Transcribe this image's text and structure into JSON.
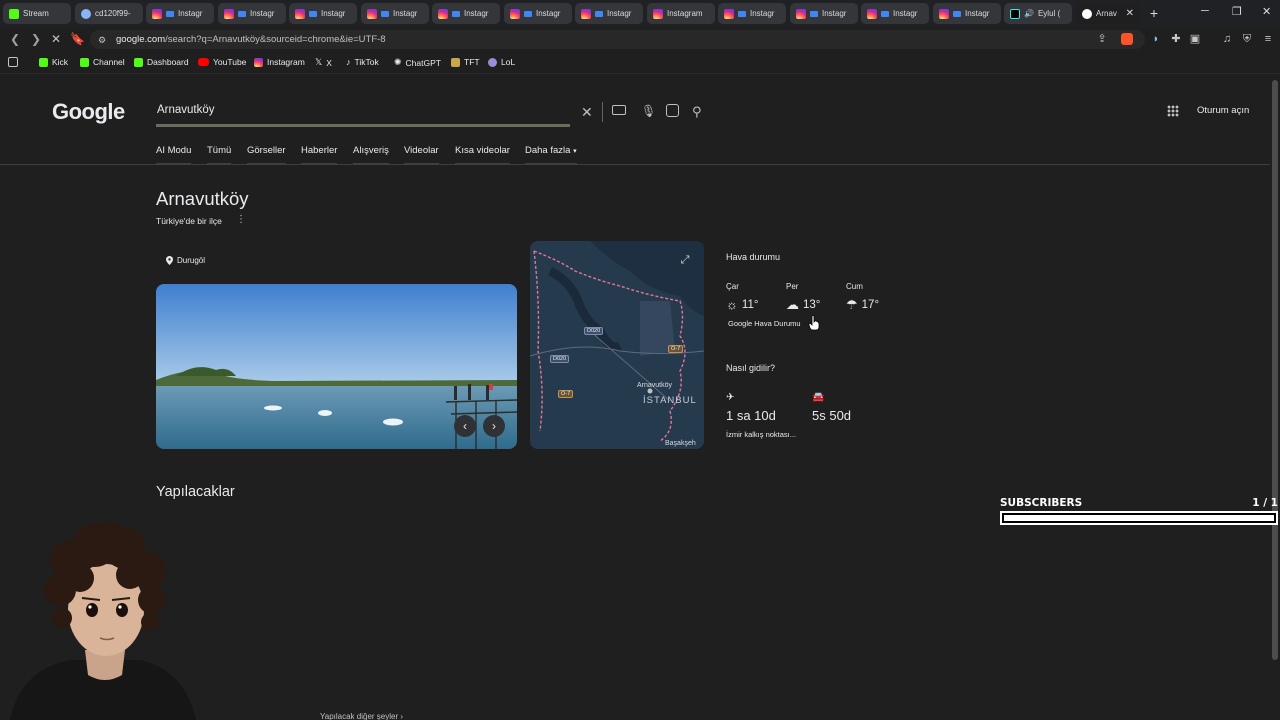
{
  "browser": {
    "tabs": [
      {
        "label": "Stream",
        "icon": "kick-icon"
      },
      {
        "label": "cd120f99-",
        "icon": "chrome-icon"
      },
      {
        "label": "Instagr",
        "icon": "instagram-icon"
      },
      {
        "label": "Instagr",
        "icon": "instagram-icon"
      },
      {
        "label": "Instagr",
        "icon": "instagram-icon"
      },
      {
        "label": "Instagr",
        "icon": "instagram-icon"
      },
      {
        "label": "Instagr",
        "icon": "instagram-icon"
      },
      {
        "label": "Instagr",
        "icon": "instagram-icon"
      },
      {
        "label": "Instagr",
        "icon": "instagram-icon"
      },
      {
        "label": "Instagram",
        "icon": "instagram-icon"
      },
      {
        "label": "Instagr",
        "icon": "instagram-icon"
      },
      {
        "label": "Instagr",
        "icon": "instagram-icon"
      },
      {
        "label": "Instagr",
        "icon": "instagram-icon"
      },
      {
        "label": "Instagr",
        "icon": "instagram-icon"
      },
      {
        "label": "Eylul (",
        "icon": "tiktok-icon"
      },
      {
        "label": "Arnav",
        "icon": "google-icon",
        "active": true
      }
    ],
    "url_prefix": "google.com",
    "url_rest": "/search?q=Arnavutköy&sourceid=chrome&ie=UTF-8",
    "bookmarks": [
      {
        "label": "Kick",
        "icon": "kick-icon"
      },
      {
        "label": "Channel",
        "icon": "kick-icon"
      },
      {
        "label": "Dashboard",
        "icon": "kick-icon"
      },
      {
        "label": "YouTube",
        "icon": "youtube-icon"
      },
      {
        "label": "Instagram",
        "icon": "instagram-icon"
      },
      {
        "label": "X",
        "icon": "x-icon"
      },
      {
        "label": "TikTok",
        "icon": "tiktok-icon"
      },
      {
        "label": "ChatGPT",
        "icon": "chatgpt-icon"
      },
      {
        "label": "TFT",
        "icon": "tft-icon"
      },
      {
        "label": "LoL",
        "icon": "lol-icon"
      }
    ]
  },
  "google": {
    "logo": "Google",
    "query": "Arnavutköy",
    "signin": "Oturum açın",
    "nav_tabs": [
      "AI Modu",
      "Tümü",
      "Görseller",
      "Haberler",
      "Alışveriş",
      "Videolar",
      "Kısa videolar",
      "Daha fazla"
    ],
    "panel": {
      "title": "Arnavutköy",
      "subtitle": "Türkiye'de bir ilçe",
      "photo_label": "Durugöl",
      "map_labels": {
        "district": "Arnavutköy",
        "city": "İSTANBUL",
        "edge": "Başakşeh",
        "roads": [
          "D020",
          "O-7",
          "D020",
          "O-7"
        ]
      },
      "weather": {
        "heading": "Hava durumu",
        "days": [
          {
            "day": "Çar",
            "temp": "11°",
            "icon": "partly-sunny-icon"
          },
          {
            "day": "Per",
            "temp": "13°",
            "icon": "cloud-icon"
          },
          {
            "day": "Cum",
            "temp": "17°",
            "icon": "rain-cloud-icon"
          }
        ],
        "source": "Google Hava Durumu"
      },
      "travel": {
        "heading": "Nasıl gidilir?",
        "flight": "1 sa 10d",
        "car": "5s 50d",
        "note": "İzmir kalkış noktası..."
      },
      "todo_heading": "Yapılacaklar",
      "more_todo": "Yapılacak diğer şeyler"
    }
  },
  "overlay": {
    "subscribers_label": "SUBSCRIBERS",
    "subscribers_count": "1 / 1",
    "subscribers_progress": 1.0
  }
}
